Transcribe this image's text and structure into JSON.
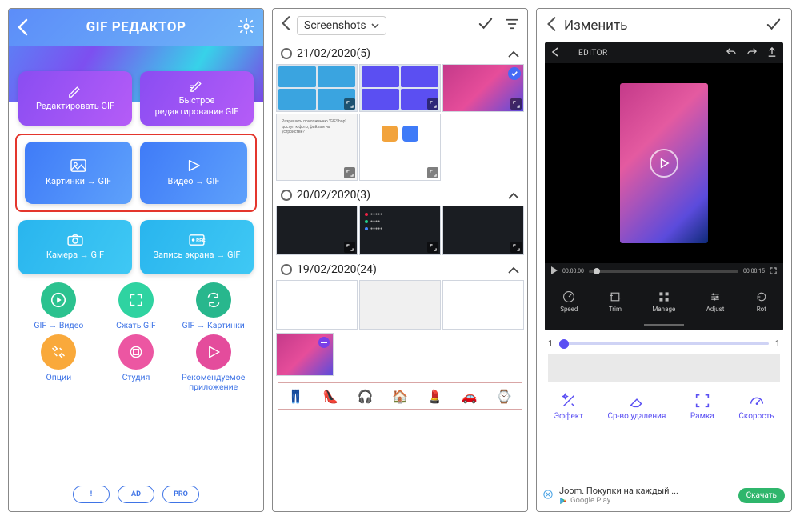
{
  "phone1": {
    "title": "GIF РЕДАКТОР",
    "tiles": {
      "edit_gif": "Редактировать GIF",
      "quick_edit": "Быстрое\nредактирование GIF",
      "pics_to_gif": "Картинки → GIF",
      "video_to_gif": "Видео → GIF",
      "camera_to_gif": "Камера → GIF",
      "screen_rec": "Запись экрана → GIF"
    },
    "grid": {
      "gif_video": "GIF → Видео",
      "compress": "Сжать GIF",
      "gif_pics": "GIF → Картинки",
      "options": "Опции",
      "studio": "Студия",
      "recommended": "Рекомендуемое\nприложение"
    },
    "footer": {
      "info": "!",
      "ad": "AD",
      "pro": "PRO"
    }
  },
  "phone2": {
    "folder": "Screenshots",
    "sections": {
      "d1": "21/02/2020(5)",
      "d2": "20/02/2020(3)",
      "d3": "19/02/2020(24)"
    },
    "emoji": [
      "👖",
      "👠",
      "🎧",
      "🏠",
      "💄",
      "🚗",
      "⌚"
    ]
  },
  "phone3": {
    "title": "Изменить",
    "editor_label": "EDITOR",
    "time_start": "00:00:00",
    "time_end": "00:00:15",
    "etools": {
      "speed": "Speed",
      "trim": "Trim",
      "manage": "Manage",
      "adjust": "Adjust",
      "rot": "Rot"
    },
    "slider": {
      "min": "1",
      "max": "1"
    },
    "tools": {
      "effect": "Эффект",
      "delete": "Ср-во удаления",
      "frame": "Рамка",
      "speed": "Скорость"
    },
    "ad": {
      "title": "Joom. Покупки на каждый ...",
      "sub": "Google Play",
      "btn": "Скачать"
    }
  }
}
